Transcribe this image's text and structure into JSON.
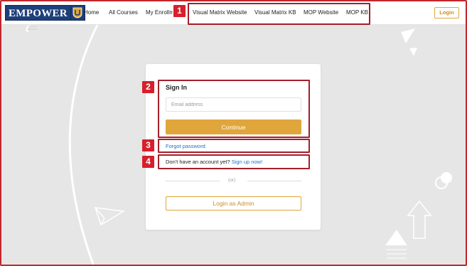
{
  "logo": {
    "text": "EMPOWER"
  },
  "nav": {
    "links": [
      "Home",
      "All Courses",
      "My Enrollments",
      "Visual Matrix Website",
      "Visual Matrix KB",
      "MOP Website",
      "MOP KB"
    ],
    "login_label": "Login"
  },
  "signin": {
    "title": "Sign In",
    "email_placeholder": "Email address",
    "email_value": "",
    "continue_label": "Continue",
    "forgot_label": "Forgot password",
    "no_account_text": "Don't have an account yet? ",
    "signup_label": "Sign up now!",
    "or_text": "(or)",
    "admin_label": "Login as Admin"
  },
  "annotations": [
    "1",
    "2",
    "3",
    "4"
  ],
  "colors": {
    "accent": "#e0a63b",
    "link": "#1a73c8",
    "annotation": "#d6202b",
    "logo_bg": "#1d3f7a"
  }
}
